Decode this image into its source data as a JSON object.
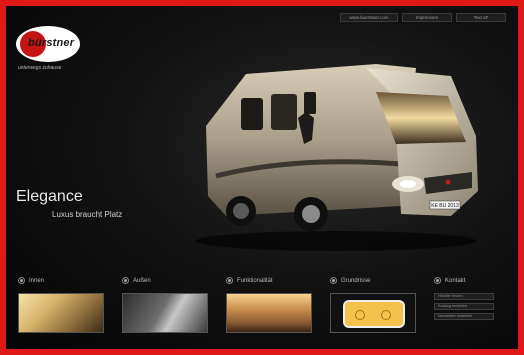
{
  "brand": {
    "logo_text": "bürstner",
    "tagline": "unterwegs zuhause"
  },
  "topnav": [
    {
      "label": "www.buerstner.com"
    },
    {
      "label": "Impressum"
    },
    {
      "label": "Text aF"
    }
  ],
  "hero": {
    "title": "Elegance",
    "subtitle": "Luxus braucht Platz",
    "plate": "KE BU 2013"
  },
  "sections": [
    {
      "label": "Innen"
    },
    {
      "label": "Außen"
    },
    {
      "label": "Funktionalität"
    },
    {
      "label": "Grundrisse"
    },
    {
      "label": "Kontakt"
    }
  ],
  "kontakt_links": [
    {
      "label": "Händler finden"
    },
    {
      "label": "Katalog bestellen"
    },
    {
      "label": "Newsletter bestellen"
    }
  ],
  "colors": {
    "border": "#e01818",
    "background": "#0b0b0b",
    "logo_red": "#c41414"
  }
}
